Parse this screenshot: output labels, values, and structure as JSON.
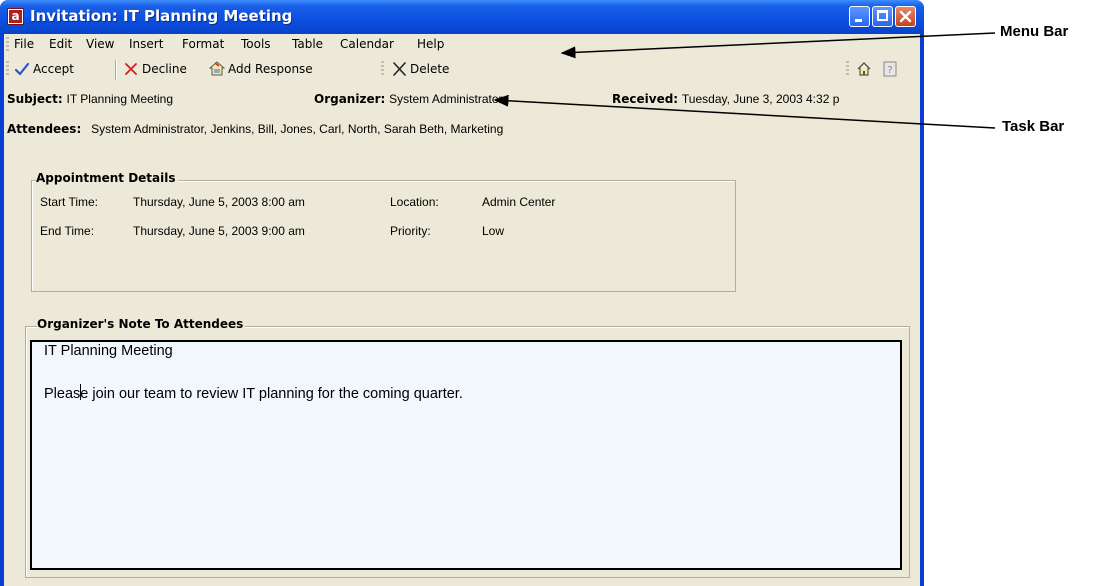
{
  "window": {
    "title": "Invitation: IT Planning Meeting",
    "app_icon_letter": "a"
  },
  "menu": {
    "items": [
      "File",
      "Edit",
      "View",
      "Insert",
      "Format",
      "Tools",
      "Table",
      "Calendar",
      "Help"
    ]
  },
  "toolbar": {
    "accept": "Accept",
    "decline": "Decline",
    "add_response": "Add Response",
    "delete": "Delete",
    "home_icon": "home-icon",
    "help_icon": "help-icon"
  },
  "header": {
    "subject_label": "Subject:",
    "subject_value": "IT Planning Meeting",
    "organizer_label": "Organizer:",
    "organizer_value": "System Administrator",
    "received_label": "Received:",
    "received_value": "Tuesday, June 3, 2003 4:32 p",
    "attendees_label": "Attendees:",
    "attendees_value": "System Administrator, Jenkins, Bill, Jones, Carl, North, Sarah Beth, Marketing"
  },
  "appointment": {
    "group_title": "Appointment Details",
    "start_label": "Start Time:",
    "start_value": "Thursday, June 5, 2003 8:00 am",
    "end_label": "End Time:",
    "end_value": "Thursday, June 5, 2003 9:00 am",
    "location_label": "Location:",
    "location_value": "Admin Center",
    "priority_label": "Priority:",
    "priority_value": "Low"
  },
  "note": {
    "group_title": "Organizer's Note To Attendees",
    "line1": "IT Planning Meeting",
    "line2_before_caret": "Pleas",
    "line2_after_caret": "e join our team to review IT planning for the coming quarter."
  },
  "annotations": {
    "menu_bar": "Menu Bar",
    "task_bar": "Task Bar"
  },
  "colors": {
    "title_blue": "#0b4fe0",
    "client_bg": "#ece9d8",
    "note_bg": "#f1f7fd",
    "accept_check": "#2a55c8",
    "decline_x": "#d42020"
  }
}
